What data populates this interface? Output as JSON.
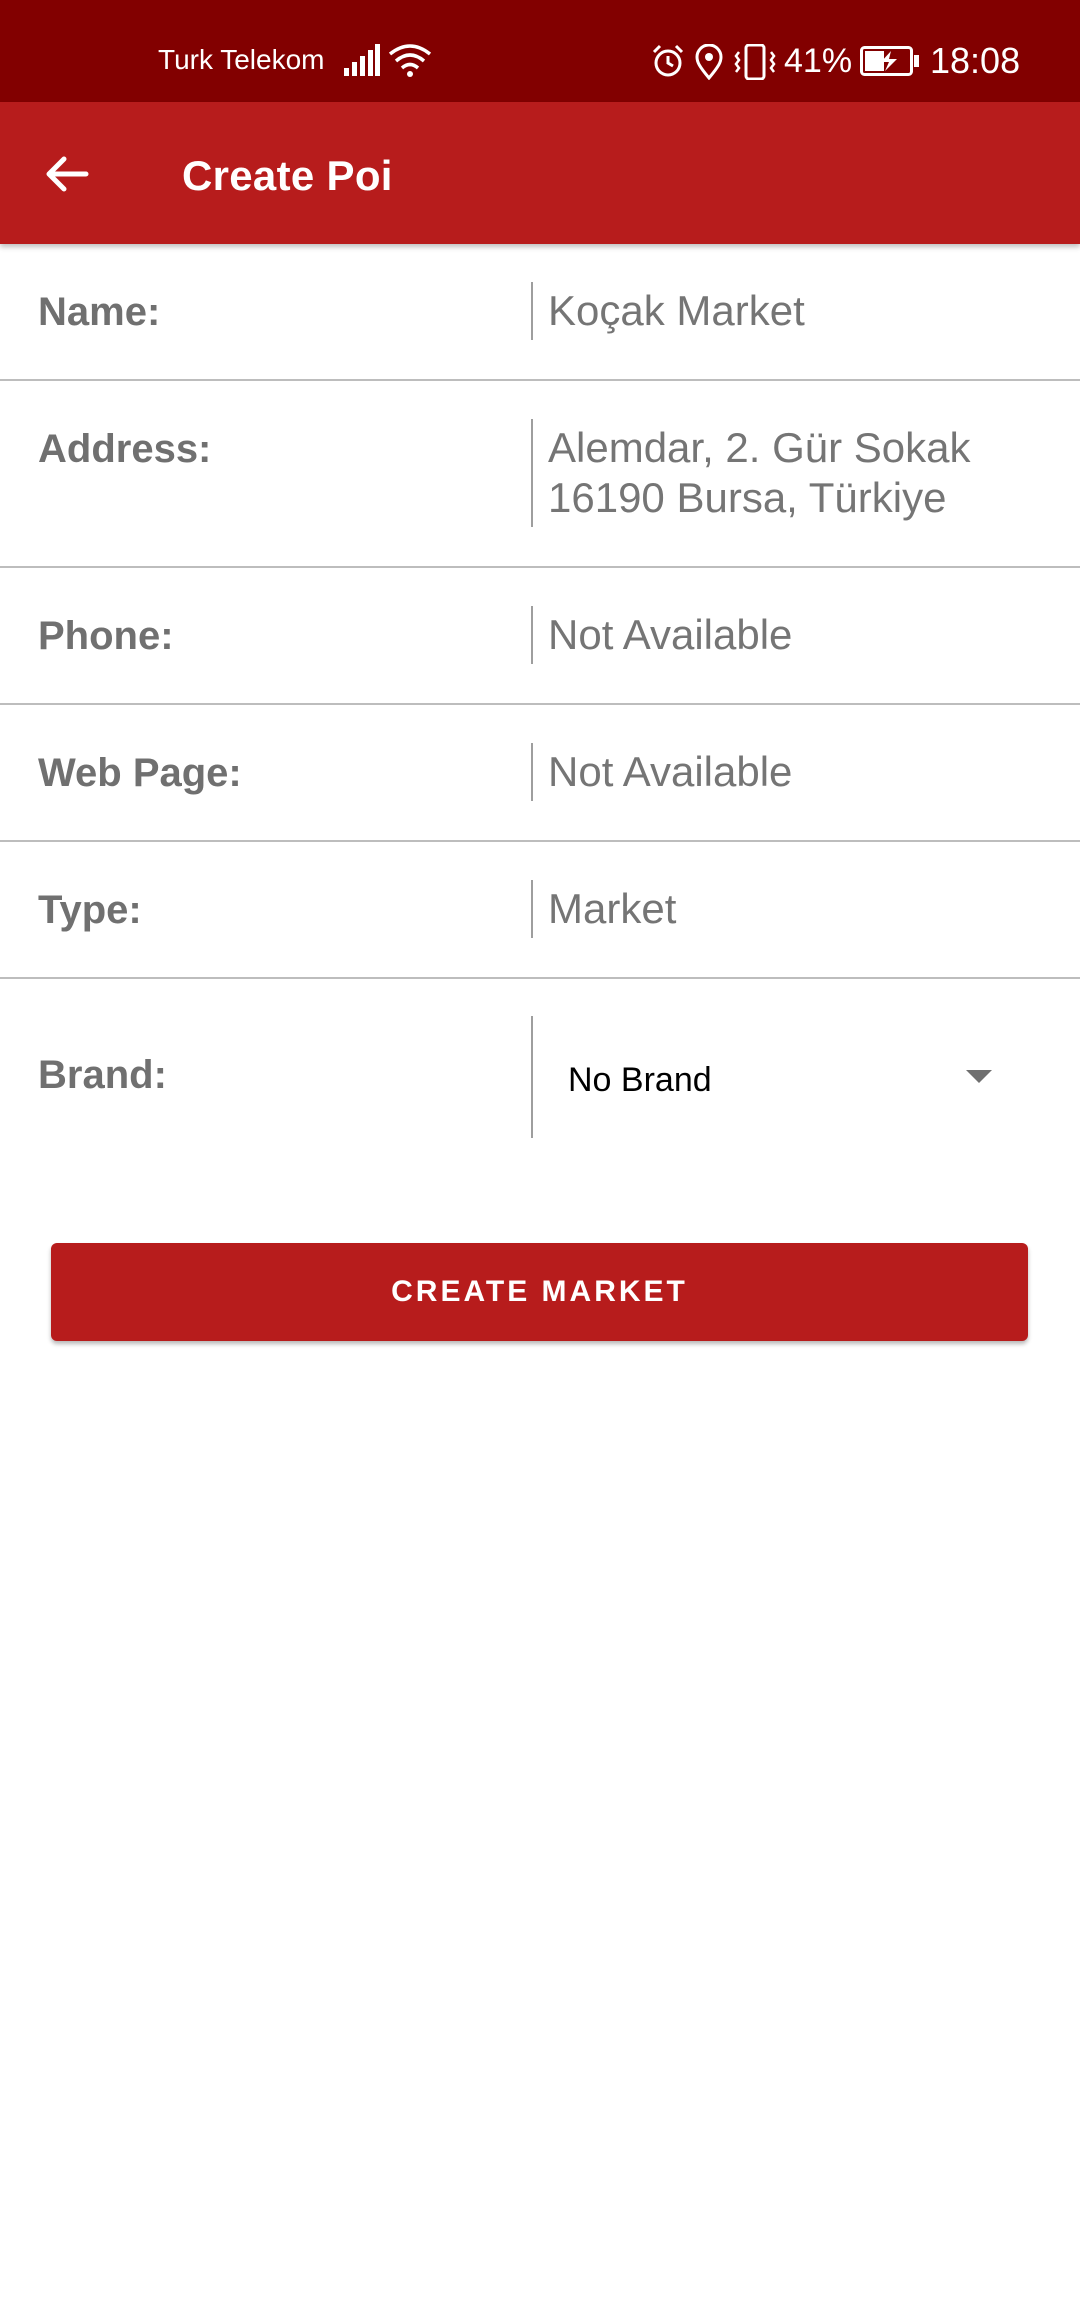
{
  "status_bar": {
    "carrier": "Turk Telekom",
    "battery_percent": "41%",
    "time": "18:08",
    "icons": [
      "signal-icon",
      "wifi-icon",
      "alarm-icon",
      "location-icon",
      "vibrate-icon",
      "battery-charging-icon"
    ]
  },
  "app_bar": {
    "title": "Create Poi",
    "back_icon": "arrow-left-icon",
    "color": "#b71c1c"
  },
  "form": {
    "name": {
      "label": "Name:",
      "value": "Koçak Market"
    },
    "address": {
      "label": "Address:",
      "value": "Alemdar, 2. Gür Sokak\n16190 Bursa, Türkiye"
    },
    "phone": {
      "label": "Phone:",
      "value": "Not Available"
    },
    "web_page": {
      "label": "Web Page:",
      "value": "Not Available"
    },
    "type": {
      "label": "Type:",
      "value": "Market"
    },
    "brand": {
      "label": "Brand:",
      "selected": "No Brand"
    }
  },
  "actions": {
    "create_label": "CREATE MARKET"
  },
  "colors": {
    "status_bar": "#820000",
    "primary": "#b71c1c"
  }
}
